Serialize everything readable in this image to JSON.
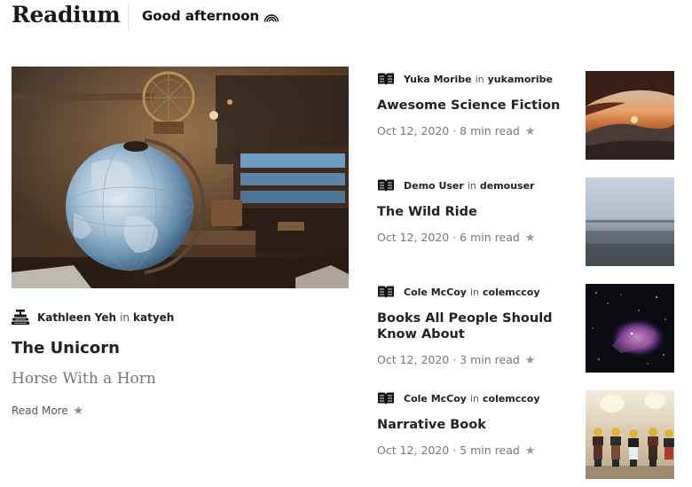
{
  "header": {
    "brand": "Readium",
    "greeting": "Good afternoon"
  },
  "featured": {
    "author": "Kathleen Yeh",
    "in_word": "in",
    "publication": "katyeh",
    "title": "The Unicorn",
    "subtitle": "Horse With a Horn",
    "read_more": "Read More",
    "star": "★"
  },
  "stories": [
    {
      "author": "Yuka Moribe",
      "in_word": "in",
      "publication": "yukamoribe",
      "title": "Awesome Science Fiction",
      "date": "Oct 12, 2020",
      "read_time": "8 min read",
      "star": "★"
    },
    {
      "author": "Demo User",
      "in_word": "in",
      "publication": "demouser",
      "title": "The Wild Ride",
      "date": "Oct 12, 2020",
      "read_time": "6 min read",
      "star": "★"
    },
    {
      "author": "Cole McCoy",
      "in_word": "in",
      "publication": "colemccoy",
      "title": "Books All People Should Know About",
      "date": "Oct 12, 2020",
      "read_time": "3 min read",
      "star": "★"
    },
    {
      "author": "Cole McCoy",
      "in_word": "in",
      "publication": "colemccoy",
      "title": "Narrative Book",
      "date": "Oct 12, 2020",
      "read_time": "5 min read",
      "star": "★"
    }
  ],
  "icons": {
    "greeting": "rainbow-icon",
    "featured_publication": "book-stack-icon",
    "story_publication": "open-book-icon"
  }
}
